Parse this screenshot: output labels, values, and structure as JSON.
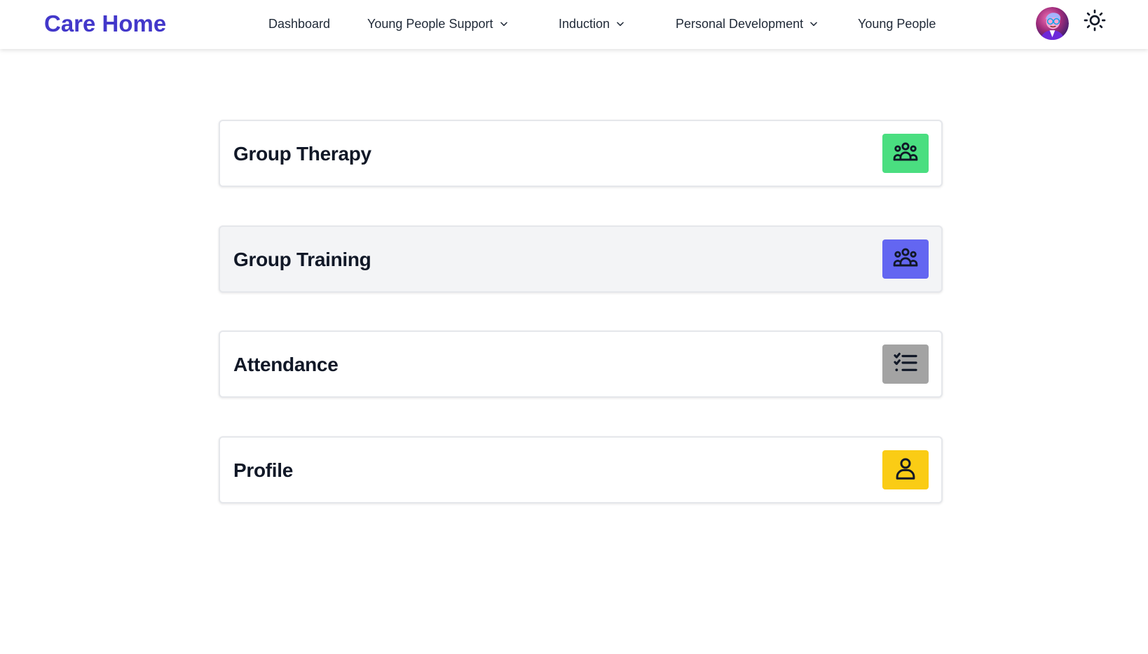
{
  "nav": {
    "brand": "Care Home",
    "items": [
      {
        "label": "Dashboard",
        "has_dropdown": false
      },
      {
        "label": "Young People Support",
        "has_dropdown": true
      },
      {
        "label": "Induction",
        "has_dropdown": true
      },
      {
        "label": "Personal Development",
        "has_dropdown": true
      },
      {
        "label": "Young People",
        "has_dropdown": false
      }
    ],
    "avatar_icon": "user-avatar",
    "theme_icon": "sun-icon"
  },
  "cards": [
    {
      "title": "Group Therapy",
      "icon": "users-group-icon",
      "icon_bg": "#4ade80"
    },
    {
      "title": "Group Training",
      "icon": "users-group-icon",
      "icon_bg": "#6366f1"
    },
    {
      "title": "Attendance",
      "icon": "checklist-icon",
      "icon_bg": "#a3a3a3"
    },
    {
      "title": "Profile",
      "icon": "user-icon",
      "icon_bg": "#facc15"
    }
  ],
  "colors": {
    "brand": "#4338ca",
    "hover_card_bg": "#f3f4f6"
  }
}
